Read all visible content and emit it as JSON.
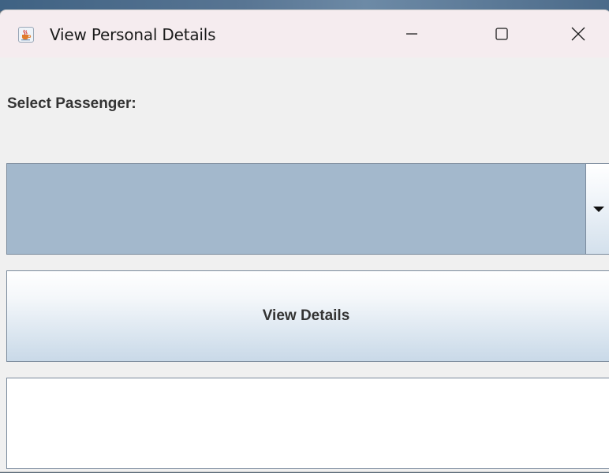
{
  "window": {
    "title": "View Personal Details",
    "icon": "java-cup-icon",
    "controls": [
      "minimize-icon",
      "maximize-icon",
      "close-icon"
    ]
  },
  "form": {
    "select_label": "Select Passenger:",
    "passenger_select": {
      "selected_value": "",
      "icon": "chevron-down-icon"
    },
    "view_button_label": "View Details",
    "details_output": ""
  },
  "colors": {
    "combo_fill": "#a3b8cc",
    "window_bg": "#f0f0f0",
    "titlebar_bg": "#f5ecef",
    "label_text": "#333333"
  }
}
